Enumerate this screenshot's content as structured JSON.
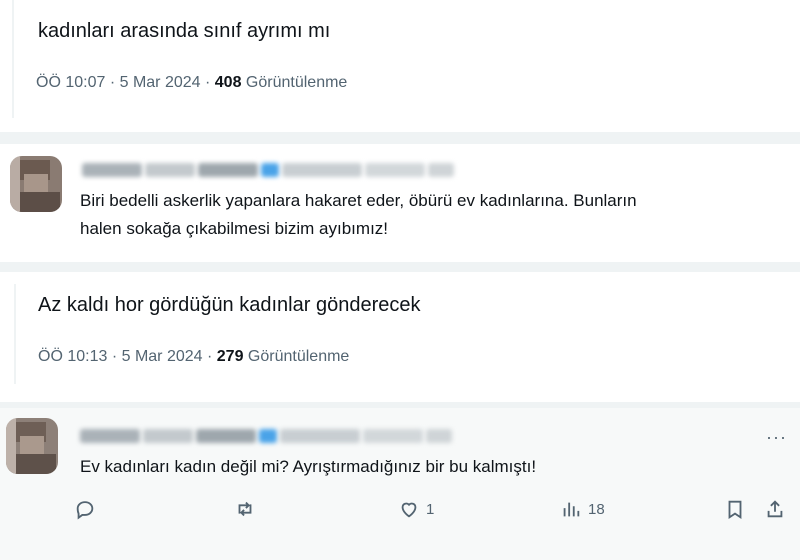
{
  "tweet1": {
    "text": "kadınları arasında sınıf ayrımı mı",
    "time": "ÖÖ 10:07 · 5 Mar 2024 ·",
    "views_count": "408",
    "views_label": "Görüntülenme"
  },
  "reply1": {
    "text_line1": "Biri bedelli askerlik yapanlara hakaret eder, öbürü ev kadınlarına. Bunların",
    "text_line2": "halen sokağa çıkabilmesi bizim ayıbımız!"
  },
  "tweet2": {
    "text": "Az kaldı hor gördüğün kadınlar gönderecek",
    "time": "ÖÖ 10:13 · 5 Mar 2024 ·",
    "views_count": "279",
    "views_label": "Görüntülenme"
  },
  "reply2": {
    "more": "···",
    "text": "Ev kadınları kadın değil mi? Ayrıştırmadığınız bir bu kalmıştı!",
    "actions": {
      "reply_icon": "comment-icon",
      "retweet_icon": "retweet-icon",
      "like_icon": "heart-icon",
      "like_count": "1",
      "views_icon": "bar-chart-icon",
      "views_count": "18",
      "bookmark_icon": "bookmark-icon",
      "share_icon": "share-icon"
    }
  },
  "colors": {
    "text": "#0f1419",
    "muted": "#536471",
    "divider": "#eff3f4",
    "blue_badge": "#4aa3e8"
  }
}
